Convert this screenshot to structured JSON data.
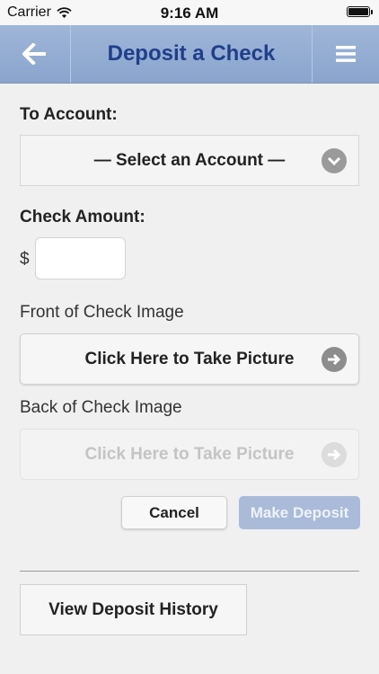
{
  "status_bar": {
    "carrier": "Carrier",
    "time": "9:16 AM",
    "wifi_icon": "wifi-icon",
    "battery_icon": "battery-icon"
  },
  "nav": {
    "title": "Deposit a Check",
    "back_icon": "back-arrow-icon",
    "menu_icon": "hamburger-menu-icon",
    "bar_color": "#95add4",
    "title_color": "#1f3f8a"
  },
  "form": {
    "to_account_label": "To Account:",
    "account_select_value": "— Select an Account —",
    "check_amount_label": "Check Amount:",
    "currency_symbol": "$",
    "amount_value": "",
    "front_label": "Front of Check Image",
    "front_button": "Click Here to Take Picture",
    "back_label": "Back of Check Image",
    "back_button": "Click Here to Take Picture",
    "cancel_button": "Cancel",
    "deposit_button": "Make Deposit"
  },
  "history_button": "View Deposit History"
}
